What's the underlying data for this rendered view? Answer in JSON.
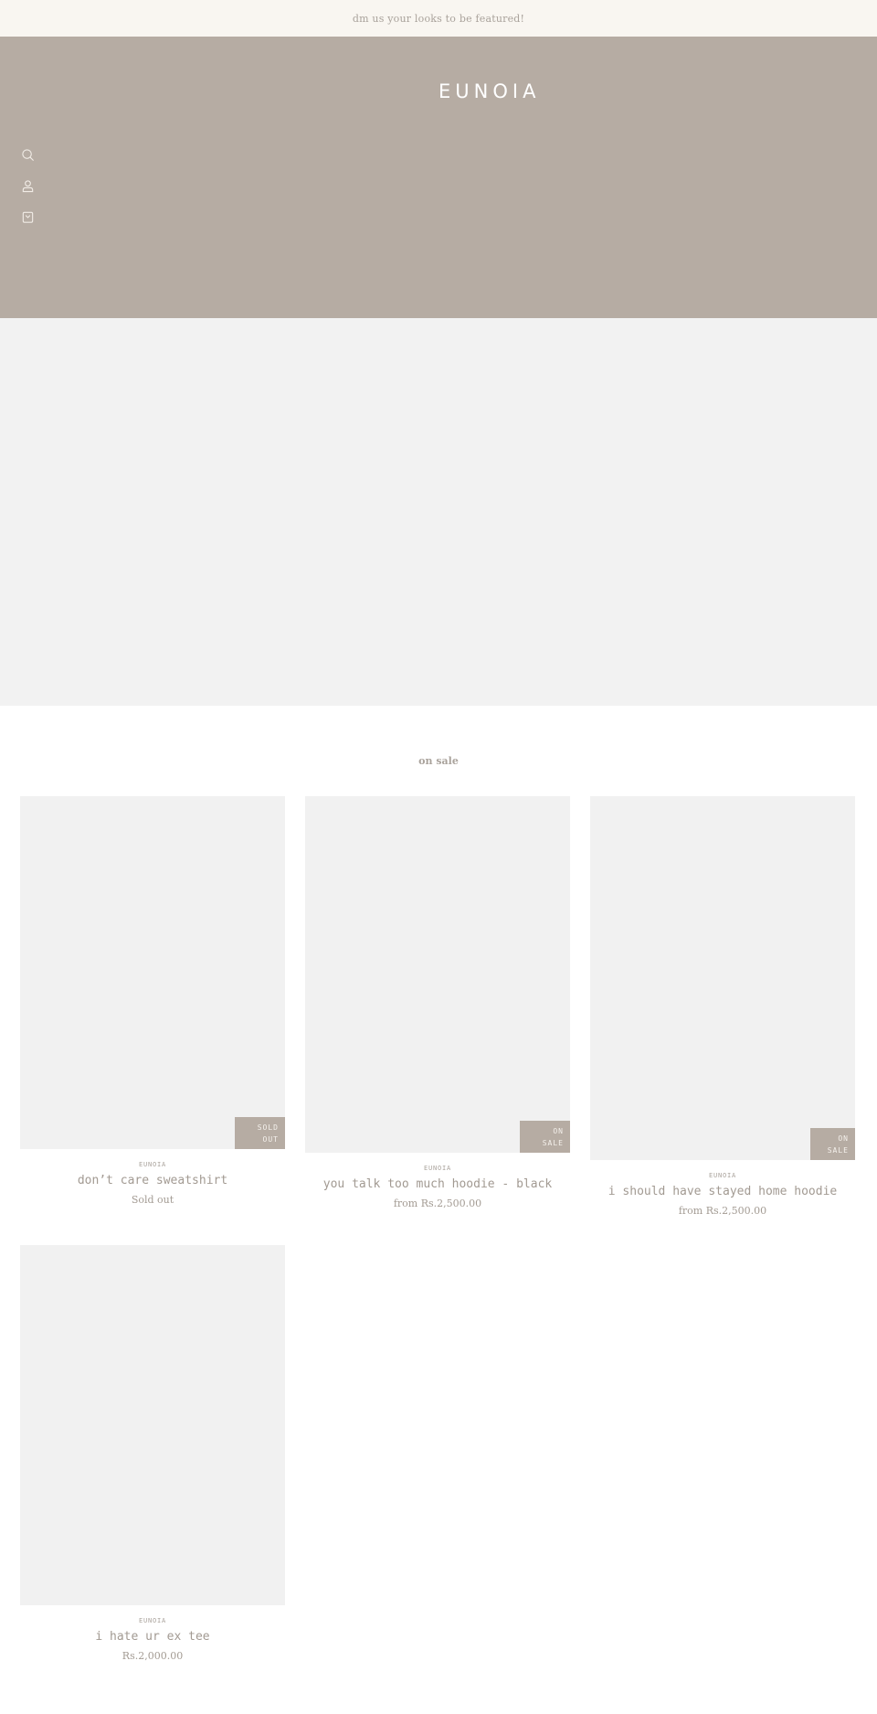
{
  "announcement": {
    "text": "dm us your looks to be featured!"
  },
  "header": {
    "logo": "EUNOIA",
    "icons": [
      {
        "name": "search-icon",
        "label": "Search"
      },
      {
        "name": "account-icon",
        "label": "Account"
      },
      {
        "name": "cart-icon",
        "label": "Cart"
      }
    ]
  },
  "collection": {
    "title": "on sale",
    "products": [
      {
        "vendor": "EUNOIA",
        "title": "don’t care sweatshirt",
        "price": "Sold out",
        "badge": [
          "SOLD",
          "OUT"
        ]
      },
      {
        "vendor": "EUNOIA",
        "title": "you talk too much hoodie - black",
        "price": "from Rs.2,500.00",
        "badge": [
          "ON",
          "SALE"
        ]
      },
      {
        "vendor": "EUNOIA",
        "title": "i should have stayed home hoodie",
        "price": "from Rs.2,500.00",
        "badge": [
          "ON",
          "SALE"
        ]
      },
      {
        "vendor": "EUNOIA",
        "title": "i hate ur ex tee",
        "price": "Rs.2,000.00",
        "badge": null
      }
    ]
  },
  "colors": {
    "header_bg": "#b6aca3",
    "announcement_bg": "#f9f6f1",
    "placeholder_bg": "#f1f1f1",
    "text_muted": "#a29a92"
  }
}
